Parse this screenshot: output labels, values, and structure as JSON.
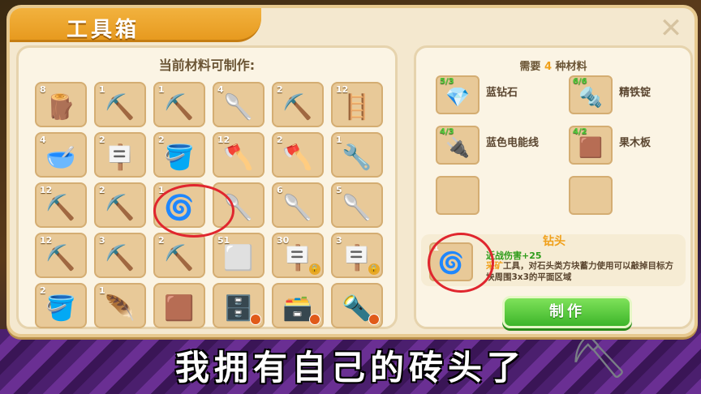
{
  "window": {
    "title": "工具箱",
    "close_glyph": "✕"
  },
  "craftable": {
    "heading": "当前材料可制作:",
    "items": [
      {
        "count": "8",
        "icon": "🪵",
        "name": "wooden-stick"
      },
      {
        "count": "1",
        "icon": "⛏️",
        "name": "wooden-pickaxe"
      },
      {
        "count": "1",
        "icon": "⛏️",
        "name": "wooden-hoe"
      },
      {
        "count": "4",
        "icon": "🥄",
        "name": "wooden-shovel"
      },
      {
        "count": "2",
        "icon": "⛏️",
        "name": "wooden-pick"
      },
      {
        "count": "12",
        "icon": "🪜",
        "name": "wooden-fence"
      },
      {
        "count": "4",
        "icon": "🥣",
        "name": "wooden-bowl"
      },
      {
        "count": "2",
        "icon": "🪧",
        "name": "signboard"
      },
      {
        "count": "2",
        "icon": "🪣",
        "name": "bucket"
      },
      {
        "count": "12",
        "icon": "🪓",
        "name": "stone-axe"
      },
      {
        "count": "2",
        "icon": "🪓",
        "name": "iron-axe"
      },
      {
        "count": "1",
        "icon": "🔧",
        "name": "saw-tool"
      },
      {
        "count": "12",
        "icon": "⛏️",
        "name": "stone-pickaxe"
      },
      {
        "count": "2",
        "icon": "⛏️",
        "name": "iron-pickaxe"
      },
      {
        "count": "1",
        "icon": "🌀",
        "name": "drill-bit"
      },
      {
        "count": "",
        "icon": "🥄",
        "name": "iron-shovel"
      },
      {
        "count": "6",
        "icon": "🥄",
        "name": "blue-shovel"
      },
      {
        "count": "5",
        "icon": "🥄",
        "name": "cyan-shovel"
      },
      {
        "count": "12",
        "icon": "⛏️",
        "name": "white-pickaxe"
      },
      {
        "count": "3",
        "icon": "⛏️",
        "name": "blue-pickaxe"
      },
      {
        "count": "2",
        "icon": "⛏️",
        "name": "cyan-pickaxe"
      },
      {
        "count": "51",
        "icon": "⬜",
        "name": "white-block"
      },
      {
        "count": "30",
        "icon": "🪧",
        "name": "billboard",
        "lock": true
      },
      {
        "count": "3",
        "icon": "🪧",
        "name": "dark-billboard",
        "lock": true
      },
      {
        "count": "2",
        "icon": "🪣",
        "name": "wooden-bucket"
      },
      {
        "count": "1",
        "icon": "🪶",
        "name": "feather"
      },
      {
        "count": "",
        "icon": "🟫",
        "name": "wooden-screen"
      },
      {
        "count": "",
        "icon": "🗄️",
        "name": "stone-furnace",
        "ban": true
      },
      {
        "count": "",
        "icon": "🗃️",
        "name": "stone-chest",
        "ban": true
      },
      {
        "count": "",
        "icon": "🔦",
        "name": "torch",
        "ban": true
      }
    ]
  },
  "requirements": {
    "prefix": "需要",
    "count": "4",
    "suffix": "种材料",
    "materials": [
      {
        "count": "5/3",
        "icon": "💎",
        "name": "蓝钻石"
      },
      {
        "count": "6/6",
        "icon": "🔩",
        "name": "精铁锭"
      },
      {
        "count": "4/3",
        "icon": "🔌",
        "name": "蓝色电能线"
      },
      {
        "count": "4/2",
        "icon": "🟫",
        "name": "果木板"
      },
      {
        "count": "",
        "icon": "",
        "name": ""
      },
      {
        "count": "",
        "icon": "",
        "name": ""
      }
    ]
  },
  "detail": {
    "title": "钻头",
    "count": "1",
    "icon": "🌀",
    "stat": "近战伤害+25",
    "desc_hl": "采矿",
    "desc_rest": "工具，对石头类方块蓄力使用可以敲掉目标方块周围3x3的平面区域"
  },
  "make_button": "制作",
  "subtitle": "我拥有自己的砖头了"
}
